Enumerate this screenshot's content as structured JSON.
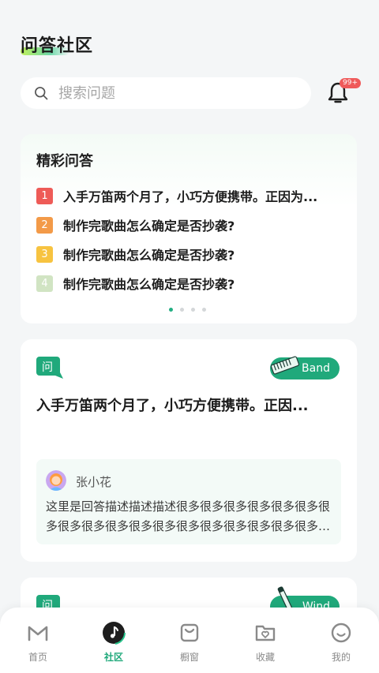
{
  "header": {
    "title": "问答社区"
  },
  "search": {
    "placeholder": "搜索问题"
  },
  "notifications": {
    "badge": "99+"
  },
  "featured": {
    "title": "精彩问答",
    "items": [
      {
        "rank": "1",
        "color": "#ee5b57",
        "text": "入手万笛两个月了，小巧方便携带。正因为..."
      },
      {
        "rank": "2",
        "color": "#f39a48",
        "text": "制作完歌曲怎么确定是否抄袭?"
      },
      {
        "rank": "3",
        "color": "#f7c340",
        "text": "制作完歌曲怎么确定是否抄袭?"
      },
      {
        "rank": "4",
        "color": "#d1e4c3",
        "text": "制作完歌曲怎么确定是否抄袭?"
      }
    ]
  },
  "questions": [
    {
      "icon_label": "问",
      "tag": "Band",
      "title": "入手万笛两个月了，小巧方便携带。正因...",
      "answer_author": "张小花",
      "answer_text": "这里是回答描述描述描述很多很多很多很多很多很多很多很多很多很多很多很多很多很多很多很多很多很多很多很多很多很多很多"
    },
    {
      "icon_label": "问",
      "tag": "Wind"
    }
  ],
  "nav": {
    "items": [
      {
        "label": "首页",
        "icon": "home-m-icon"
      },
      {
        "label": "社区",
        "icon": "community-music-icon"
      },
      {
        "label": "橱窗",
        "icon": "shop-bag-icon"
      },
      {
        "label": "收藏",
        "icon": "favorites-folder-icon"
      },
      {
        "label": "我的",
        "icon": "profile-smile-icon"
      }
    ],
    "active": "社区"
  },
  "colors": {
    "accent": "#20a97b",
    "badge": "#ef5a5a"
  }
}
